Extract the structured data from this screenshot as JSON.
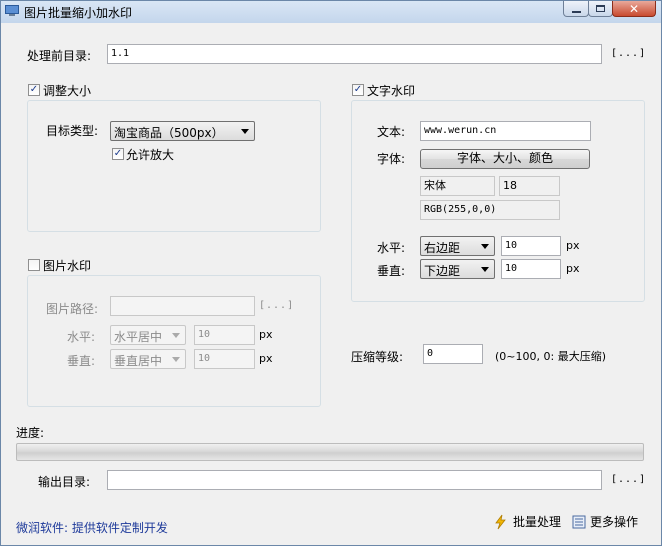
{
  "window": {
    "title": "图片批量缩小加水印",
    "close_glyph": "✕"
  },
  "source": {
    "label": "处理前目录:",
    "value": "1.1",
    "browse": "[...]"
  },
  "resize": {
    "checkbox_label": "调整大小",
    "checked": true,
    "target_type_label": "目标类型:",
    "target_type_value": "淘宝商品（500px）",
    "allow_enlarge_label": "允许放大",
    "allow_enlarge_checked": true
  },
  "image_watermark": {
    "checkbox_label": "图片水印",
    "checked": false,
    "path_label": "图片路径:",
    "path_value": "",
    "browse": "[...]",
    "h_label": "水平:",
    "h_align": "水平居中",
    "h_offset": "10",
    "h_unit": "px",
    "v_label": "垂直:",
    "v_align": "垂直居中",
    "v_offset": "10",
    "v_unit": "px"
  },
  "text_watermark": {
    "checkbox_label": "文字水印",
    "checked": true,
    "text_label": "文本:",
    "text_value": "www.werun.cn",
    "font_label": "字体:",
    "font_button": "字体、大小、颜色",
    "font_name": "宋体",
    "font_size": "18",
    "color": "RGB(255,0,0)",
    "h_label": "水平:",
    "h_align": "右边距",
    "h_offset": "10",
    "h_unit": "px",
    "v_label": "垂直:",
    "v_align": "下边距",
    "v_offset": "10",
    "v_unit": "px"
  },
  "compression": {
    "label": "压缩等级:",
    "value": "0",
    "hint": "(0~100, 0: 最大压缩)"
  },
  "progress": {
    "label": "进度:",
    "value": 0
  },
  "output": {
    "label": "输出目录:",
    "value": "",
    "browse": "[...]"
  },
  "footer": {
    "link": "微润软件: 提供软件定制开发",
    "batch_button": "批量处理",
    "more_button": "更多操作"
  },
  "colors": {
    "title_bg": "#c4d6ec",
    "link": "#1e3a9a",
    "close_red": "#c94a2f"
  }
}
